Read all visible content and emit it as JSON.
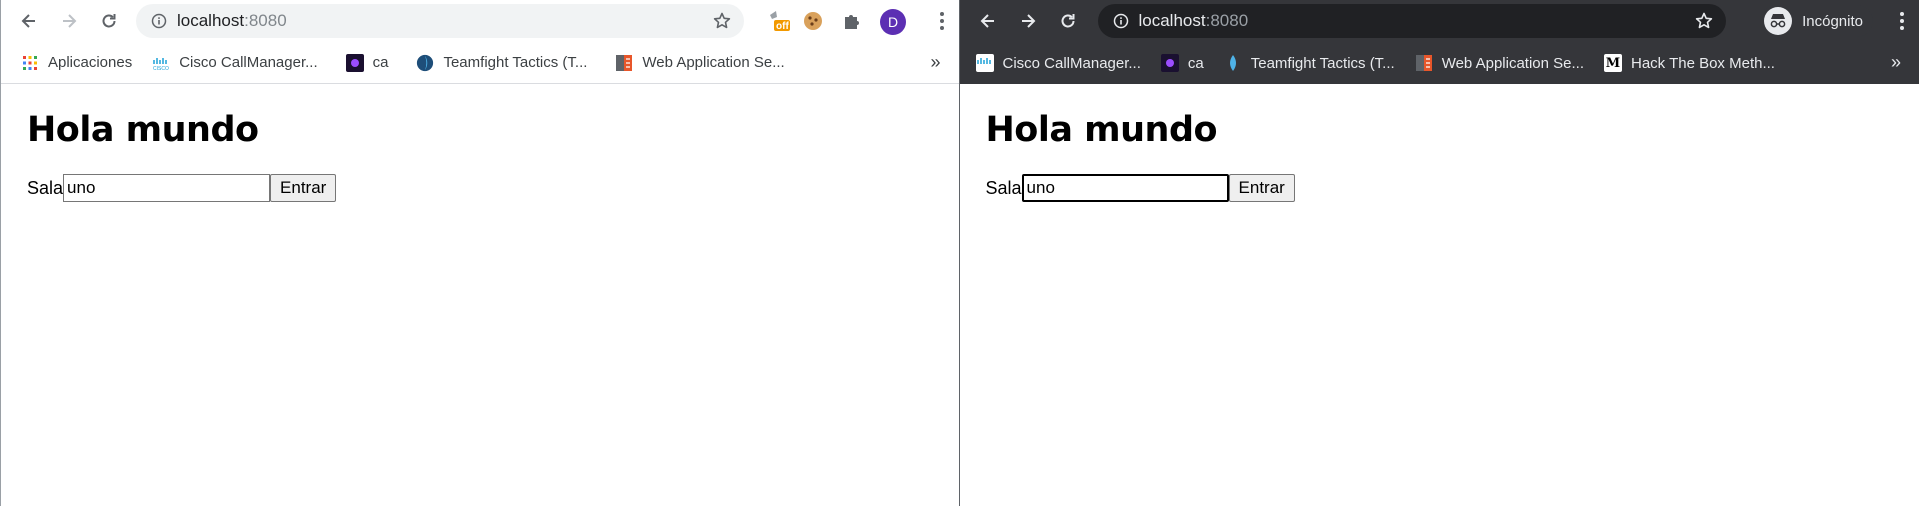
{
  "left_window": {
    "url_host": "localhost",
    "url_port": ":8080",
    "extensions": {
      "badge_text": "off",
      "profile_initial": "D"
    },
    "bookmarks": [
      {
        "label": "Aplicaciones",
        "icon": "apps-grid-icon"
      },
      {
        "label": "Cisco CallManager...",
        "icon": "cisco-icon"
      },
      {
        "label": "ca",
        "icon": "ca-icon"
      },
      {
        "label": "Teamfight Tactics (T...",
        "icon": "teamfight-icon"
      },
      {
        "label": "Web Application Se...",
        "icon": "webapp-icon"
      }
    ],
    "bookmarks_more": "»",
    "page": {
      "heading": "Hola mundo",
      "label": "Sala",
      "input_value": "uno",
      "button_label": "Entrar"
    }
  },
  "right_window": {
    "url_host": "localhost",
    "url_port": ":8080",
    "incognito_label": "Incógnito",
    "bookmarks": [
      {
        "label": "Cisco CallManager...",
        "icon": "cisco-icon"
      },
      {
        "label": "ca",
        "icon": "ca-icon"
      },
      {
        "label": "Teamfight Tactics (T...",
        "icon": "teamfight-icon"
      },
      {
        "label": "Web Application Se...",
        "icon": "webapp-icon"
      },
      {
        "label": "Hack The Box Meth...",
        "icon": "medium-icon"
      }
    ],
    "bookmarks_more": "»",
    "page": {
      "heading": "Hola mundo",
      "label": "Sala",
      "input_value": "uno",
      "button_label": "Entrar"
    }
  },
  "colors": {
    "profile_avatar": "#5c2fb3",
    "extension_badge": "#f29900",
    "incognito_toolbar": "#35363a",
    "incognito_omnibox": "#202124"
  }
}
